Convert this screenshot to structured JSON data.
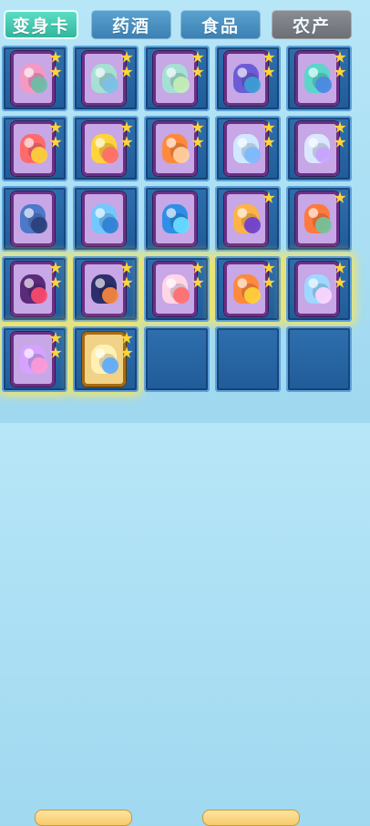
{
  "tabs": [
    {
      "label": "变身卡",
      "active": true
    },
    {
      "label": "药酒",
      "active": false
    },
    {
      "label": "食品",
      "active": false
    },
    {
      "label": "农产",
      "active": false
    }
  ],
  "grid": {
    "rows": 5,
    "cols": 5,
    "items": [
      {
        "stars": 2,
        "card": "purple",
        "glow": false,
        "icon": "transformation-card-icon"
      },
      {
        "stars": 2,
        "card": "purple",
        "glow": false,
        "icon": "transformation-card-icon"
      },
      {
        "stars": 2,
        "card": "purple",
        "glow": false,
        "icon": "transformation-card-icon"
      },
      {
        "stars": 2,
        "card": "purple",
        "glow": false,
        "icon": "transformation-card-icon"
      },
      {
        "stars": 2,
        "card": "purple",
        "glow": false,
        "icon": "transformation-card-icon"
      },
      {
        "stars": 2,
        "card": "purple",
        "glow": false,
        "icon": "transformation-card-icon"
      },
      {
        "stars": 2,
        "card": "purple",
        "glow": false,
        "icon": "transformation-card-icon"
      },
      {
        "stars": 2,
        "card": "purple",
        "glow": false,
        "icon": "transformation-card-icon"
      },
      {
        "stars": 2,
        "card": "purple",
        "glow": false,
        "icon": "transformation-card-icon"
      },
      {
        "stars": 2,
        "card": "purple",
        "glow": false,
        "icon": "transformation-card-icon"
      },
      {
        "stars": 0,
        "card": "purple",
        "glow": false,
        "icon": "transformation-card-icon"
      },
      {
        "stars": 0,
        "card": "purple",
        "glow": false,
        "icon": "transformation-card-icon"
      },
      {
        "stars": 0,
        "card": "purple",
        "glow": false,
        "icon": "transformation-card-icon"
      },
      {
        "stars": 1,
        "card": "purple",
        "glow": false,
        "icon": "transformation-card-icon"
      },
      {
        "stars": 1,
        "card": "purple",
        "glow": false,
        "icon": "transformation-card-icon"
      },
      {
        "stars": 2,
        "card": "purple",
        "glow": true,
        "icon": "transformation-card-icon"
      },
      {
        "stars": 2,
        "card": "purple",
        "glow": true,
        "icon": "transformation-card-icon"
      },
      {
        "stars": 2,
        "card": "purple",
        "glow": true,
        "icon": "transformation-card-icon"
      },
      {
        "stars": 2,
        "card": "purple",
        "glow": true,
        "icon": "transformation-card-icon"
      },
      {
        "stars": 2,
        "card": "purple",
        "glow": true,
        "icon": "transformation-card-icon"
      },
      {
        "stars": 2,
        "card": "purple",
        "glow": true,
        "icon": "transformation-card-icon"
      },
      {
        "stars": 2,
        "card": "gold",
        "glow": true,
        "icon": "transformation-card-icon"
      },
      null,
      null,
      null
    ]
  },
  "colors": {
    "active_tab": "#2fb39a",
    "tab_blue": "#3b7fb2",
    "tab_gray": "#6b6f74",
    "cell_bg": "#1f5b98",
    "card_purple": "#c7a7e6",
    "card_gold": "#f1d287",
    "star": "#ffd43b"
  }
}
